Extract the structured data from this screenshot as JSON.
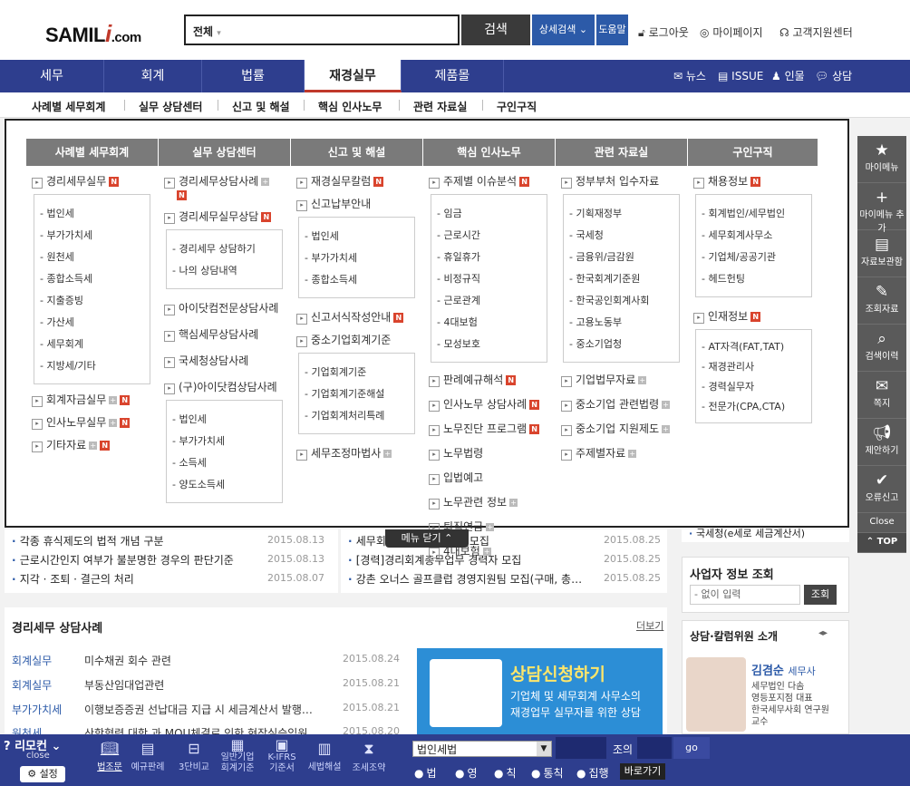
{
  "header": {
    "logo": {
      "a": "SAMIL",
      "i": "i",
      "b": ".com"
    },
    "search": {
      "scope": "전체",
      "placeholder": ""
    },
    "search_button": "검색",
    "advanced_search": "상세검색",
    "help": "도움말",
    "util": [
      "로그아웃",
      "마이페이지",
      "고객지원센터"
    ]
  },
  "nav": {
    "menus": [
      "세무",
      "회계",
      "법률",
      "재경실무",
      "제품몰"
    ],
    "right": [
      "뉴스",
      "ISSUE",
      "인물",
      "상담"
    ]
  },
  "subnav": [
    "사례별 세무회계",
    "실무 상담센터",
    "신고 및 해설",
    "핵심 인사노무",
    "관련 자료실",
    "구인구직"
  ],
  "mega": {
    "col1": {
      "title": "사례별 세무회계",
      "top": "경리세무실무",
      "box": [
        "법인세",
        "부가가치세",
        "원천세",
        "종합소득세",
        "지출증빙",
        "가산세",
        "세무회계",
        "지방세/기타"
      ],
      "after": [
        "회계자금실무",
        "인사노무실무",
        "기타자료"
      ]
    },
    "col2": {
      "title": "실무 상담센터",
      "items1": [
        "경리세무상담사례",
        "경리세무실무상담"
      ],
      "box1": [
        "경리세무 상담하기",
        "나의 상담내역"
      ],
      "items2": [
        "아이닷컴전문상담사례",
        "핵심세무상담사례",
        "국세청상담사례",
        "(구)아이닷컴상담사례"
      ],
      "box2": [
        "법인세",
        "부가가치세",
        "소득세",
        "양도소득세"
      ]
    },
    "col3": {
      "title": "신고 및 해설",
      "items1": [
        "재경실무칼럼",
        "신고납부안내"
      ],
      "box1": [
        "법인세",
        "부가가치세",
        "종합소득세"
      ],
      "items2": [
        "신고서식작성안내",
        "중소기업회계기준"
      ],
      "box2": [
        "기업회계기준",
        "기업회계기준해설",
        "기업회계처리특례"
      ],
      "items3": [
        "세무조정마법사"
      ]
    },
    "col4": {
      "title": "핵심 인사노무",
      "top": "주제별 이슈분석",
      "box": [
        "임금",
        "근로시간",
        "휴일휴가",
        "비정규직",
        "근로관계",
        "4대보험",
        "모성보호"
      ],
      "after": [
        "판례예규해석",
        "인사노무 상담사례",
        "노무진단 프로그램",
        "노무법령",
        "입법예고",
        "노무관련 정보",
        "퇴직연금",
        "4대보험"
      ]
    },
    "col5": {
      "title": "관련 자료실",
      "top": "정부부처 입수자료",
      "box": [
        "기획재정부",
        "국세청",
        "금융위/금감원",
        "한국회계기준원",
        "한국공인회계사회",
        "고용노동부",
        "중소기업청"
      ],
      "after": [
        "기업법무자료",
        "중소기업 관련법령",
        "중소기업 지원제도",
        "주제별자료"
      ]
    },
    "col6": {
      "title": "구인구직",
      "top1": "채용정보",
      "box1": [
        "회계법인/세무법인",
        "세무회계사무소",
        "기업체/공공기관",
        "헤드헌팅"
      ],
      "top2": "인재정보",
      "box2": [
        "AT자격(FAT,TAT)",
        "재경관리사",
        "경력실무자",
        "전문가(CPA,CTA)"
      ]
    },
    "close_label": "메뉴 닫기"
  },
  "news_left": [
    {
      "title": "각종 휴식제도의 법적 개념 구분",
      "date": "2015.08.13"
    },
    {
      "title": "근로시간인지 여부가 불분명한 경우의 판단기준",
      "date": "2015.08.13"
    },
    {
      "title": "지각 · 조퇴 · 결근의 처리",
      "date": "2015.08.07"
    }
  ],
  "news_right": [
    {
      "title": "세무회",
      "suffix": "모집",
      "date": "2015.08.25"
    },
    {
      "title": "[경력]경리회계총무업무 경력자 모집",
      "date": "2015.08.25"
    },
    {
      "title": "강촌 오너스 골프클럽 경영지원팀 모집(구매, 총…",
      "date": "2015.08.25"
    }
  ],
  "right_top": "국세청(e세로 세금계산서)",
  "biz": {
    "title": "사업자 정보 조회",
    "placeholder": "- 없이 입력",
    "button": "조회"
  },
  "consult": {
    "title": "경리세무 상담사례",
    "more": "더보기",
    "rows": [
      {
        "cat": "회계실무",
        "title": "미수채권 회수 관련",
        "date": "2015.08.24"
      },
      {
        "cat": "회계실무",
        "title": "부동산임대업관련",
        "date": "2015.08.21"
      },
      {
        "cat": "부가가치세",
        "title": "이행보증증권 선납대금 지급 시 세금계산서 발행…",
        "date": "2015.08.21"
      },
      {
        "cat": "원천세",
        "title": "산학협력 대학 과 MOU체결로 인한 현장실습임원…",
        "date": "2015.08.20"
      }
    ]
  },
  "promo": {
    "title": "상담신청하기",
    "line1": "기업체 및 세무회계 사무소의",
    "line2": "재경업무 실무자를 위한 상담"
  },
  "advisor": {
    "title": "상담·칼럼위원 소개",
    "name": "김겸순",
    "role": "세무사",
    "lines": [
      "세무법인 다솜",
      "영등포지점 대표",
      "한국세무사회 연구원",
      "교수"
    ]
  },
  "sidebar": [
    "마이메뉴",
    "마이메뉴 추가",
    "자료보관함",
    "조회자료",
    "검색이력",
    "쪽지",
    "제안하기",
    "오류신고",
    "Close",
    "TOP"
  ],
  "bottom": {
    "remocon": "리모컨",
    "close": "close",
    "settings": "설정",
    "items": [
      "법조문",
      "예규판례",
      "3단비교",
      "일반기업 회계기준",
      "K-IFRS 기준서",
      "세법해설",
      "조세조약"
    ],
    "law_select": "법인세법",
    "article": "조의",
    "go": "go",
    "radios": [
      "법",
      "영",
      "칙",
      "통칙",
      "집행"
    ],
    "shortcut": "바로가기"
  }
}
